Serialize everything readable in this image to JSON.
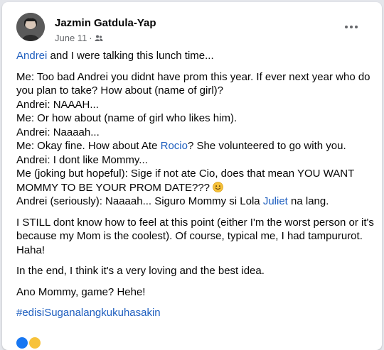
{
  "post": {
    "author": "Jazmin Gatdula-Yap",
    "date": "June 11",
    "separator": "·",
    "audience_icon": "friends-icon",
    "more_icon": "more-options-icon",
    "body": {
      "intro_link": "Andrei",
      "intro_rest": " and I were talking this lunch time...",
      "lines": {
        "l1": "Me: Too bad Andrei you didnt have prom this year. If ever next year who do you plan to take? How about (name of girl)?",
        "l2": "Andrei: NAAAH...",
        "l3": "Me: Or how about (name of girl who likes him).",
        "l4": "Andrei: Naaaah...",
        "l5_pre": "Me: Okay fine. How about Ate ",
        "l5_link": "Rocio",
        "l5_post": "? She volunteered to go with you.",
        "l6": "Andrei: I dont like Mommy...",
        "l7": "Me (joking but hopeful): Sige if not ate Cio, does that mean YOU WANT MOMMY TO BE YOUR PROM DATE??? ",
        "l7_emoji": "smiling-face-emoji",
        "l8_pre": "Andrei (seriously): Naaaah... Siguro Mommy si Lola ",
        "l8_link": "Juliet",
        "l8_post": " na lang."
      },
      "p3": "I STILL dont know how to feel at this point (either I'm the worst person or it's because my Mom is the coolest). Of course, typical me, I had tampururot. Haha!",
      "p4": "In the end, I think it's a very loving and the best idea.",
      "p5": "Ano Mommy, game? Hehe!",
      "hashtag": "#edisiSuganalangkukuhasakin"
    }
  },
  "colors": {
    "link": "#1f5fbf",
    "meta": "#65676b",
    "text": "#050505",
    "background": "#e4e6eb",
    "card": "#ffffff"
  }
}
